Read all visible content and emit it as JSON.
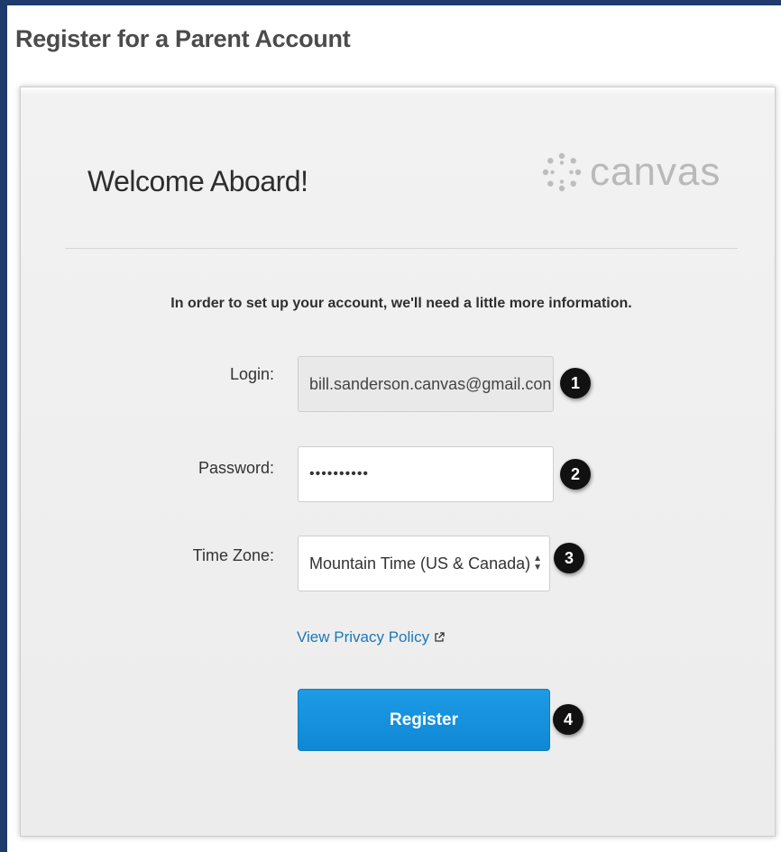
{
  "page": {
    "title": "Register for a Parent Account"
  },
  "card": {
    "welcome": "Welcome Aboard!",
    "logo_text": "canvas",
    "intro": "In order to set up your account, we'll need a little more information."
  },
  "form": {
    "login": {
      "label": "Login:",
      "value": "bill.sanderson.canvas@gmail.con"
    },
    "password": {
      "label": "Password:",
      "value": "••••••••••"
    },
    "timezone": {
      "label": "Time Zone:",
      "value": "Mountain Time (US & Canada)"
    },
    "privacy_link": "View Privacy Policy",
    "register_label": "Register"
  },
  "badges": [
    "1",
    "2",
    "3",
    "4"
  ],
  "colors": {
    "frame": "#1f3a6d",
    "accent": "#1a94de",
    "link": "#1e77b7",
    "logo": "#b9b9b9"
  },
  "icons": {
    "logo": "canvas-logo-icon",
    "external": "external-link-icon",
    "select": "select-arrows-icon"
  }
}
